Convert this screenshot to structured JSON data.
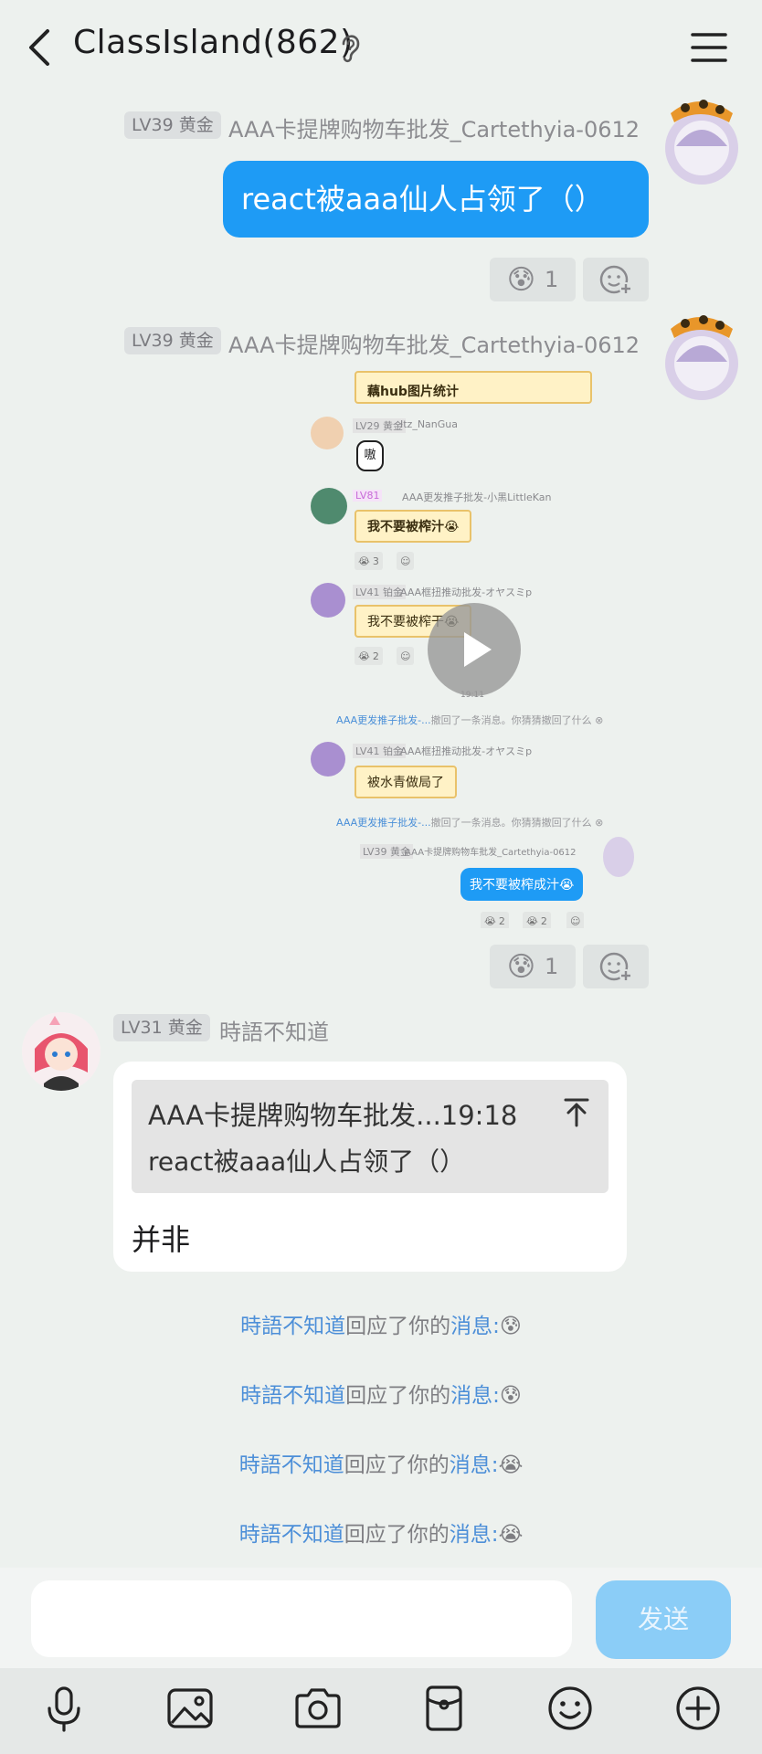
{
  "header": {
    "title": "ClassIsland(862)"
  },
  "messages": {
    "m1": {
      "level": "LV39 黄金",
      "sender": "AAA卡提牌购物车批发_Cartethyia-0612",
      "text": "react被aaa仙人占领了（）",
      "reaction_count": "1"
    },
    "m2": {
      "level": "LV39 黄金",
      "sender": "AAA卡提牌购物车批发_Cartethyia-0612",
      "reaction_count": "1",
      "shot": {
        "top_bubble": "藕hub图片统计",
        "u1_level": "LV29 黄金",
        "u1_name": "Itz_NanGua",
        "u1_text": "嗷",
        "u2_level": "LV81",
        "u2_name": "AAA更发推子批发-小黑LittleKan",
        "u2_text": "我不要被榨汁😭",
        "u2_reaction": "3",
        "u3_level": "LV41 铂金",
        "u3_name": "AAA框扭推动批发-オヤスミp",
        "u3_text": "我不要被榨干😭",
        "u3_reaction": "2",
        "time": "19:11",
        "recall1_name": "AAA更发推子批发-...",
        "recall1_text": "撤回了一条消息。你猜猜撤回了什么",
        "u4_level": "LV41 铂金",
        "u4_name": "AAA框扭推动批发-オヤスミp",
        "u4_text": "被水青做局了",
        "recall2_name": "AAA更发推子批发-...",
        "recall2_text": "撤回了一条消息。你猜猜撤回了什么",
        "u5_level": "LV39 黄金",
        "u5_name": "AAA卡提牌购物车批发_Cartethyia-0612",
        "u5_text": "我不要被榨成汁😭",
        "u5_r1": "2",
        "u5_r2": "2"
      }
    },
    "m3": {
      "level": "LV31 黄金",
      "sender": "時語不知道",
      "quote_header": "AAA卡提牌购物车批发...19:18",
      "quote_text": "react被aaa仙人占领了（）",
      "text": "并非"
    }
  },
  "notices": [
    {
      "name": "時語不知道",
      "mid": "回应了你的",
      "link": "消息:",
      "emoji": "😰"
    },
    {
      "name": "時語不知道",
      "mid": "回应了你的",
      "link": "消息:",
      "emoji": "😰"
    },
    {
      "name": "時語不知道",
      "mid": "回应了你的",
      "link": "消息:",
      "emoji": "😭"
    },
    {
      "name": "時語不知道",
      "mid": "回应了你的",
      "link": "消息:",
      "emoji": "😭"
    }
  ],
  "input": {
    "send_label": "发送"
  },
  "reaction_emoji": "😰",
  "colors": {
    "accent": "#1e9bf5",
    "link": "#4d8fd8",
    "background": "#edf1ee"
  }
}
